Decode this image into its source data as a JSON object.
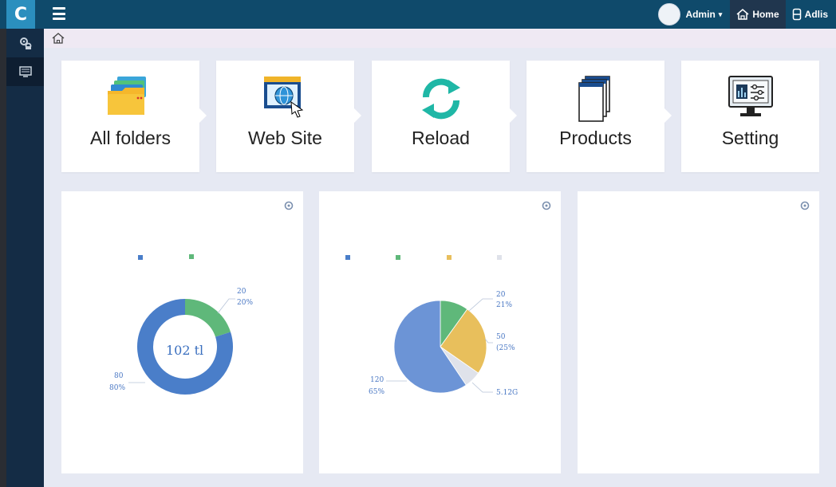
{
  "header": {
    "logo_text": "C",
    "user_name": "Admin",
    "user_caret": "▾",
    "home_label": "Home",
    "adlis_label": "Adlis"
  },
  "sidebar": {
    "items": [
      {
        "icon": "gears-icon",
        "active": false
      },
      {
        "icon": "monitor-icon",
        "active": true
      }
    ]
  },
  "breadcrumb": {
    "icon": "home-icon"
  },
  "tiles": [
    {
      "label": "All folders",
      "icon": "folders-icon"
    },
    {
      "label": "Web Site",
      "icon": "website-icon"
    },
    {
      "label": "Reload",
      "icon": "reload-icon"
    },
    {
      "label": "Products",
      "icon": "products-icon"
    },
    {
      "label": "Setting",
      "icon": "settings-monitor-icon"
    }
  ],
  "panels": [
    {
      "chart_data": {
        "type": "pie",
        "style": "donut",
        "center_label": "102 tl",
        "slices": [
          {
            "value": 20,
            "percent_label": "20%",
            "value_label": "20",
            "color": "#5fb87a"
          },
          {
            "value": 80,
            "percent_label": "80%",
            "value_label": "80",
            "color": "#4a7ec9"
          }
        ],
        "legend_colors": [
          "#4a7ec9",
          "#5fb87a"
        ]
      }
    },
    {
      "chart_data": {
        "type": "pie",
        "slices": [
          {
            "value": 20,
            "percent_label": "21%",
            "value_label": "20",
            "color": "#5fb87a"
          },
          {
            "value": 50,
            "percent_label": "(25%",
            "value_label": "50",
            "color": "#e8bf5c"
          },
          {
            "value": 12,
            "percent_label": "",
            "value_label": "5.12G",
            "color": "#dfe2ea"
          },
          {
            "value": 120,
            "percent_label": "65%",
            "value_label": "120",
            "color": "#6c94d6"
          }
        ],
        "legend_colors": [
          "#4a7ec9",
          "#5fb87a",
          "#e8bf5c",
          "#dfe2ea"
        ]
      }
    },
    {
      "empty": true
    }
  ],
  "colors": {
    "topbar": "#0f4a6b",
    "sidebar": "#142c45",
    "accent": "#2b8fbe"
  }
}
